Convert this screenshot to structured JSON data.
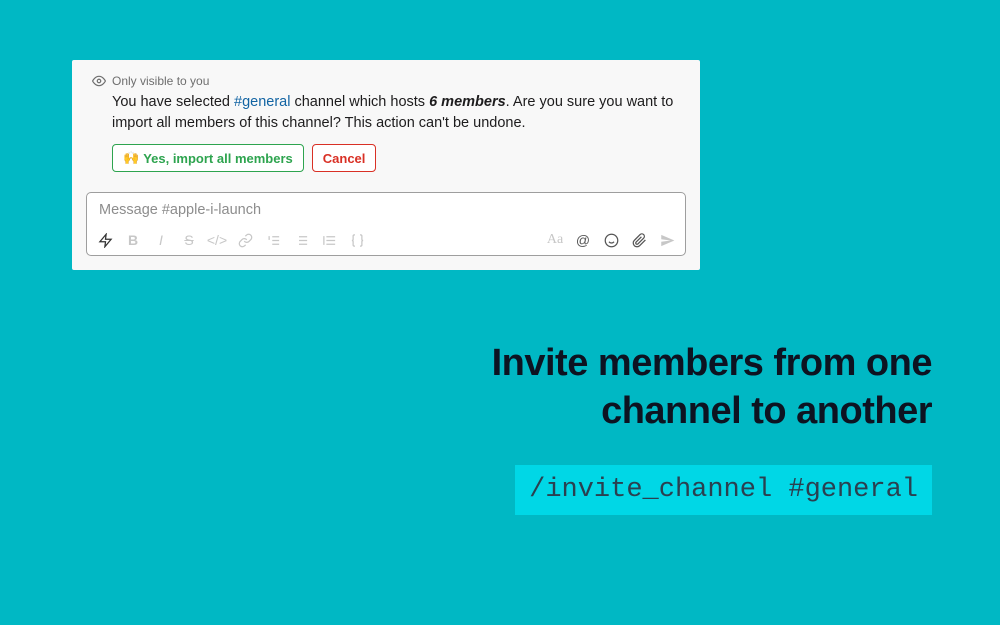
{
  "notice": {
    "label": "Only visible to you"
  },
  "message": {
    "prefix": "You have selected ",
    "channel": "#general",
    "mid": " channel which hosts ",
    "count": "6 members",
    "suffix": ". Are you sure you want to import all members of this channel? This action can't be undone."
  },
  "buttons": {
    "confirm_emoji": "🙌",
    "confirm": "Yes, import all members",
    "cancel": "Cancel"
  },
  "composer": {
    "placeholder": "Message #apple-i-launch"
  },
  "toolbar": {
    "aa": "Aa"
  },
  "headline": {
    "line1": "Invite members from one",
    "line2": "channel to another"
  },
  "command": {
    "text": "/invite_channel #general"
  }
}
